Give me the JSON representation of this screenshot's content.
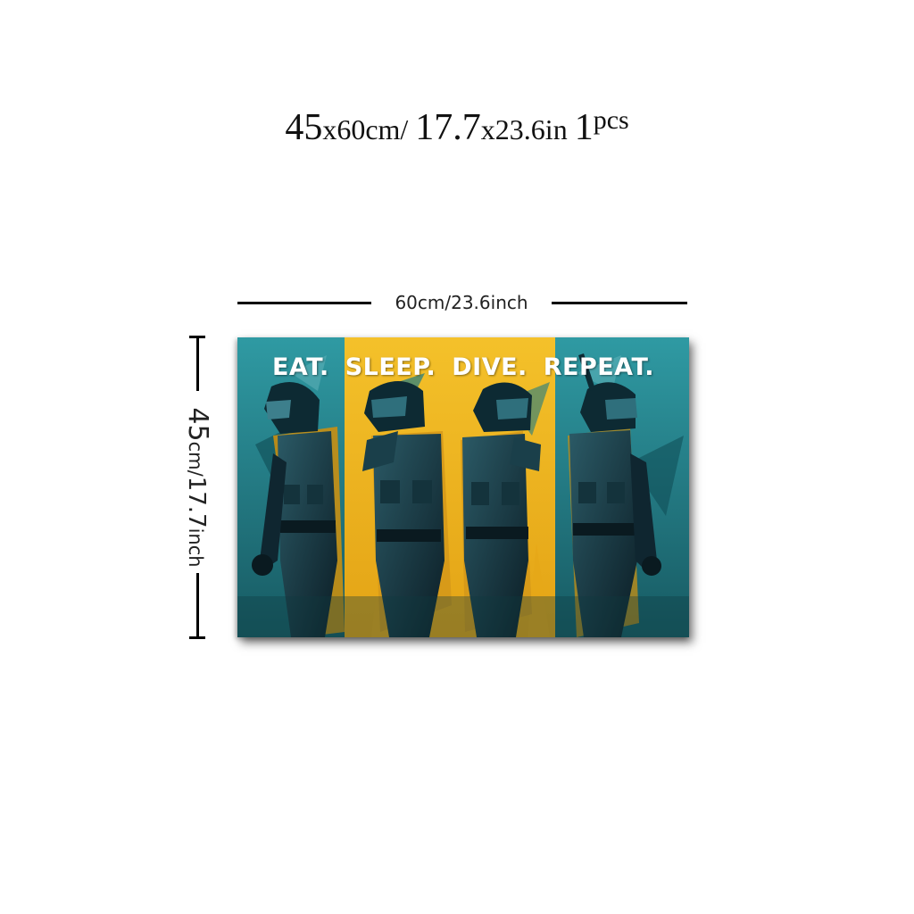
{
  "headline": {
    "width_cm": "45",
    "by_cm": "x60cm/",
    "height_in": "17.7",
    "by_in": "x23.6in",
    "qty": "1",
    "unit": "pcs"
  },
  "dimensions": {
    "width_label": "60cm/23.6inch",
    "height_number": "45",
    "height_unit": "cm/",
    "height_number_in": "17.7",
    "height_unit_in": "inch"
  },
  "artwork": {
    "slogan_words": [
      "EAT.",
      "SLEEP.",
      "DIVE.",
      "REPEAT."
    ],
    "colors": {
      "teal": "#2a8a94",
      "dark_teal": "#14474f",
      "yellow": "#f0b81e",
      "armor": "#0f2630"
    }
  }
}
